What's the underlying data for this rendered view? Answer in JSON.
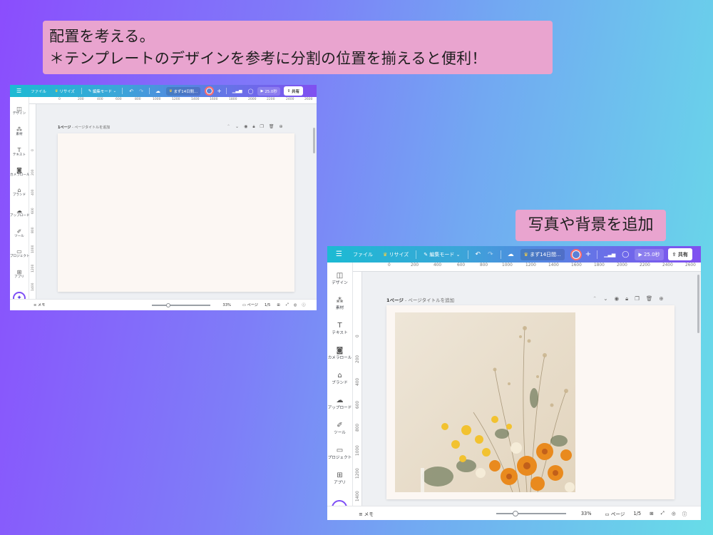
{
  "callouts": {
    "top_line1": "配置を考える。",
    "top_line2": "＊テンプレートのデザインを参考に分割の位置を揃えると便利！",
    "right": "写真や背景を追加"
  },
  "editor": {
    "menu_icon": "hamburger-icon",
    "file": "ファイル",
    "resize": "リサイズ",
    "edit_mode": "編集モード",
    "project_name": "まず14日間...",
    "timer": "25.0秒",
    "share": "共有",
    "sidebar": [
      {
        "label": "デザイン",
        "icon": "design-icon"
      },
      {
        "label": "素材",
        "icon": "elements-icon"
      },
      {
        "label": "テキスト",
        "icon": "text-icon"
      },
      {
        "label": "カメラロール",
        "icon": "camera-icon"
      },
      {
        "label": "ブランド",
        "icon": "brand-icon"
      },
      {
        "label": "アップロード",
        "icon": "upload-icon"
      },
      {
        "label": "ツール",
        "icon": "tools-icon"
      },
      {
        "label": "プロジェクト",
        "icon": "folder-icon"
      },
      {
        "label": "アプリ",
        "icon": "apps-icon"
      }
    ],
    "ruler_h": [
      "0",
      "200",
      "400",
      "600",
      "800",
      "1000",
      "1200",
      "1400",
      "1600",
      "1800",
      "2000",
      "2200",
      "2400",
      "2600"
    ],
    "ruler_h_b": [
      "0",
      "200",
      "400",
      "600",
      "800",
      "1000",
      "1200",
      "1400",
      "1600",
      "1800",
      "2000",
      "2200",
      "2400",
      "2600"
    ],
    "ruler_v": [
      "0",
      "200",
      "400",
      "600",
      "800",
      "1000",
      "1200",
      "1400",
      "1600",
      "1800"
    ],
    "page_number": "1ページ",
    "page_title_placeholder": " - ページタイトルを追加",
    "memo": "メモ",
    "zoom": "33%",
    "page_label": "ページ",
    "page_count": "1/5",
    "zoom_level": 0.28
  },
  "colors": {
    "accent": "#7d2ae8",
    "canvas": "#fcf7f3"
  }
}
